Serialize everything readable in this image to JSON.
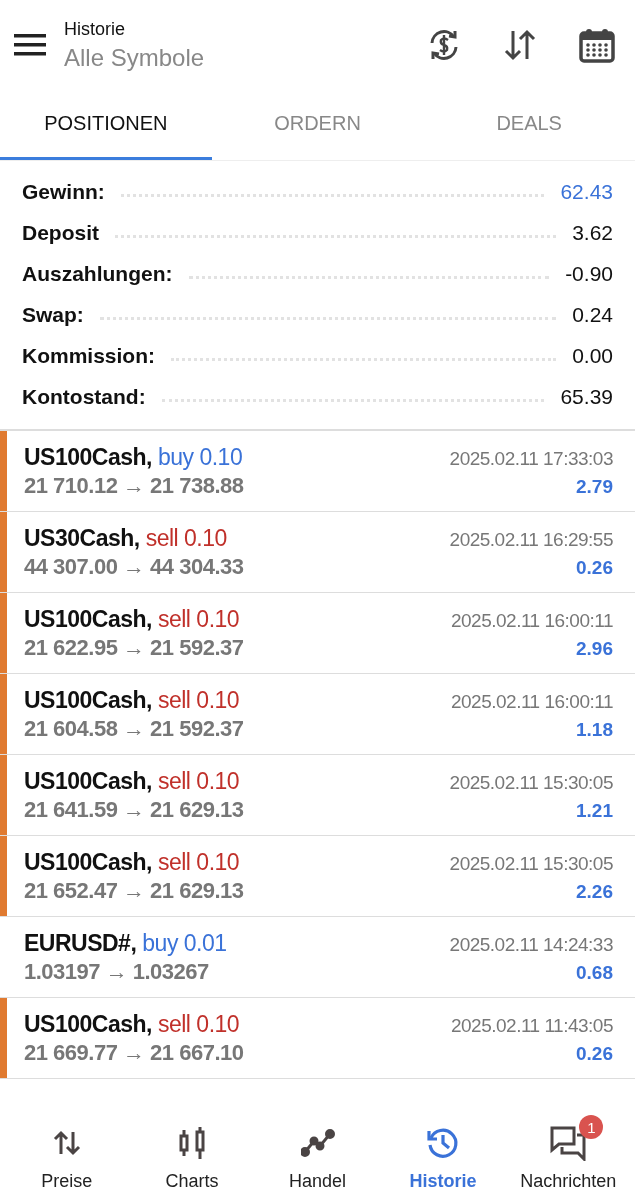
{
  "header": {
    "title": "Historie",
    "subtitle": "Alle Symbole"
  },
  "tabs": [
    {
      "label": "POSITIONEN",
      "selected": true
    },
    {
      "label": "ORDERN",
      "selected": false
    },
    {
      "label": "DEALS",
      "selected": false
    }
  ],
  "summary": [
    {
      "label": "Gewinn:",
      "value": "62.43",
      "highlight": true
    },
    {
      "label": "Deposit",
      "value": "3.62",
      "highlight": false
    },
    {
      "label": "Auszahlungen:",
      "value": "-0.90",
      "highlight": false
    },
    {
      "label": "Swap:",
      "value": "0.24",
      "highlight": false
    },
    {
      "label": "Kommission:",
      "value": "0.00",
      "highlight": false
    },
    {
      "label": "Kontostand:",
      "value": "65.39",
      "highlight": false
    }
  ],
  "positions": [
    {
      "symbol": "US100Cash,",
      "kind": "buy",
      "order": "buy 0.10",
      "time": "2025.02.11 17:33:03",
      "prices": "21 710.12 → 21 738.88",
      "profit": "2.79",
      "marked": true
    },
    {
      "symbol": "US30Cash,",
      "kind": "sell",
      "order": "sell 0.10",
      "time": "2025.02.11 16:29:55",
      "prices": "44 307.00 → 44 304.33",
      "profit": "0.26",
      "marked": true
    },
    {
      "symbol": "US100Cash,",
      "kind": "sell",
      "order": "sell 0.10",
      "time": "2025.02.11 16:00:11",
      "prices": "21 622.95 → 21 592.37",
      "profit": "2.96",
      "marked": true
    },
    {
      "symbol": "US100Cash,",
      "kind": "sell",
      "order": "sell 0.10",
      "time": "2025.02.11 16:00:11",
      "prices": "21 604.58 → 21 592.37",
      "profit": "1.18",
      "marked": true
    },
    {
      "symbol": "US100Cash,",
      "kind": "sell",
      "order": "sell 0.10",
      "time": "2025.02.11 15:30:05",
      "prices": "21 641.59 → 21 629.13",
      "profit": "1.21",
      "marked": true
    },
    {
      "symbol": "US100Cash,",
      "kind": "sell",
      "order": "sell 0.10",
      "time": "2025.02.11 15:30:05",
      "prices": "21 652.47 → 21 629.13",
      "profit": "2.26",
      "marked": true
    },
    {
      "symbol": "EURUSD#,",
      "kind": "buy",
      "order": "buy 0.01",
      "time": "2025.02.11 14:24:33",
      "prices": "1.03197 → 1.03267",
      "profit": "0.68",
      "marked": false
    },
    {
      "symbol": "US100Cash,",
      "kind": "sell",
      "order": "sell 0.10",
      "time": "2025.02.11 11:43:05",
      "prices": "21 669.77 → 21 667.10",
      "profit": "0.26",
      "marked": true
    }
  ],
  "nav": [
    {
      "kind": "prices",
      "label": "Preise",
      "selected": false
    },
    {
      "kind": "charts",
      "label": "Charts",
      "selected": false
    },
    {
      "kind": "trade",
      "label": "Handel",
      "selected": false
    },
    {
      "kind": "history",
      "label": "Historie",
      "selected": true
    },
    {
      "kind": "messages",
      "label": "Nachrichten",
      "selected": false,
      "badge": "1"
    }
  ]
}
